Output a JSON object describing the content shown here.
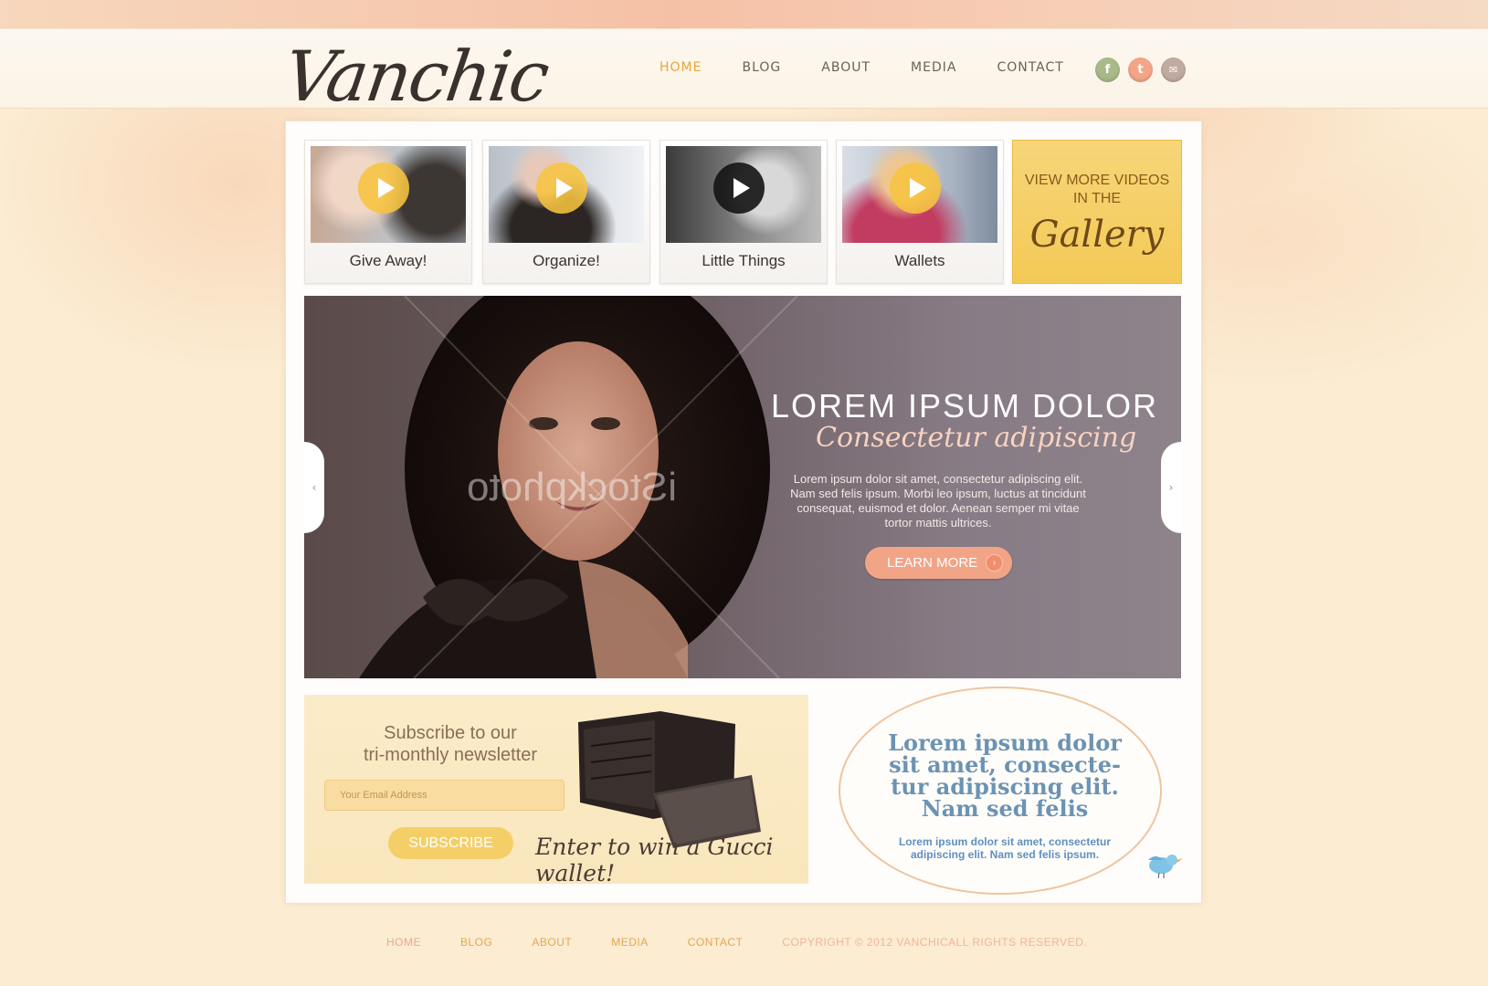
{
  "brand": {
    "logo_text": "Vanchic"
  },
  "nav": {
    "items": [
      {
        "label": "HOME",
        "active": true
      },
      {
        "label": "BLOG",
        "active": false
      },
      {
        "label": "ABOUT",
        "active": false
      },
      {
        "label": "MEDIA",
        "active": false
      },
      {
        "label": "CONTACT",
        "active": false
      }
    ]
  },
  "social": {
    "facebook": "f",
    "twitter": "t",
    "email": "✉"
  },
  "videos": [
    {
      "caption": "Give Away!"
    },
    {
      "caption": "Organize!"
    },
    {
      "caption": "Little Things"
    },
    {
      "caption": "Wallets"
    }
  ],
  "gallery": {
    "line1": "VIEW MORE VIDEOS",
    "line2": "IN THE",
    "script": "Gallery"
  },
  "hero": {
    "title": "LOREM IPSUM DOLOR",
    "subtitle": "Consectetur adipiscing",
    "text": "Lorem ipsum dolor sit amet, consectetur adipiscing elit. Nam sed felis ipsum. Morbi leo ipsum, luctus at tincidunt consequat, euismod et dolor. Aenean semper mi vitae tortor mattis ultrices.",
    "button": "LEARN MORE",
    "watermark": "iStockphoto"
  },
  "newsletter": {
    "title_line1": "Subscribe to our",
    "title_line2": "tri-monthly newsletter",
    "email_placeholder": "Your Email Address",
    "button": "SUBSCRIBE",
    "promo": "Enter to win a Gucci wallet!"
  },
  "tweet": {
    "headline": "Lorem ipsum dolor sit amet, consecte-tur adipiscing elit. Nam sed felis",
    "text": "Lorem ipsum dolor sit amet, consectetur adipiscing elit. Nam sed felis ipsum."
  },
  "footer": {
    "links": [
      "HOME",
      "BLOG",
      "ABOUT",
      "MEDIA",
      "CONTACT"
    ],
    "copyright": "COPYRIGHT © 2012 VANCHICALL RIGHTS RESERVED."
  },
  "colors": {
    "accent": "#e8a53a",
    "salmon": "#f2a487",
    "gold": "#f4cf68",
    "tweet_blue": "#6b93b3"
  }
}
